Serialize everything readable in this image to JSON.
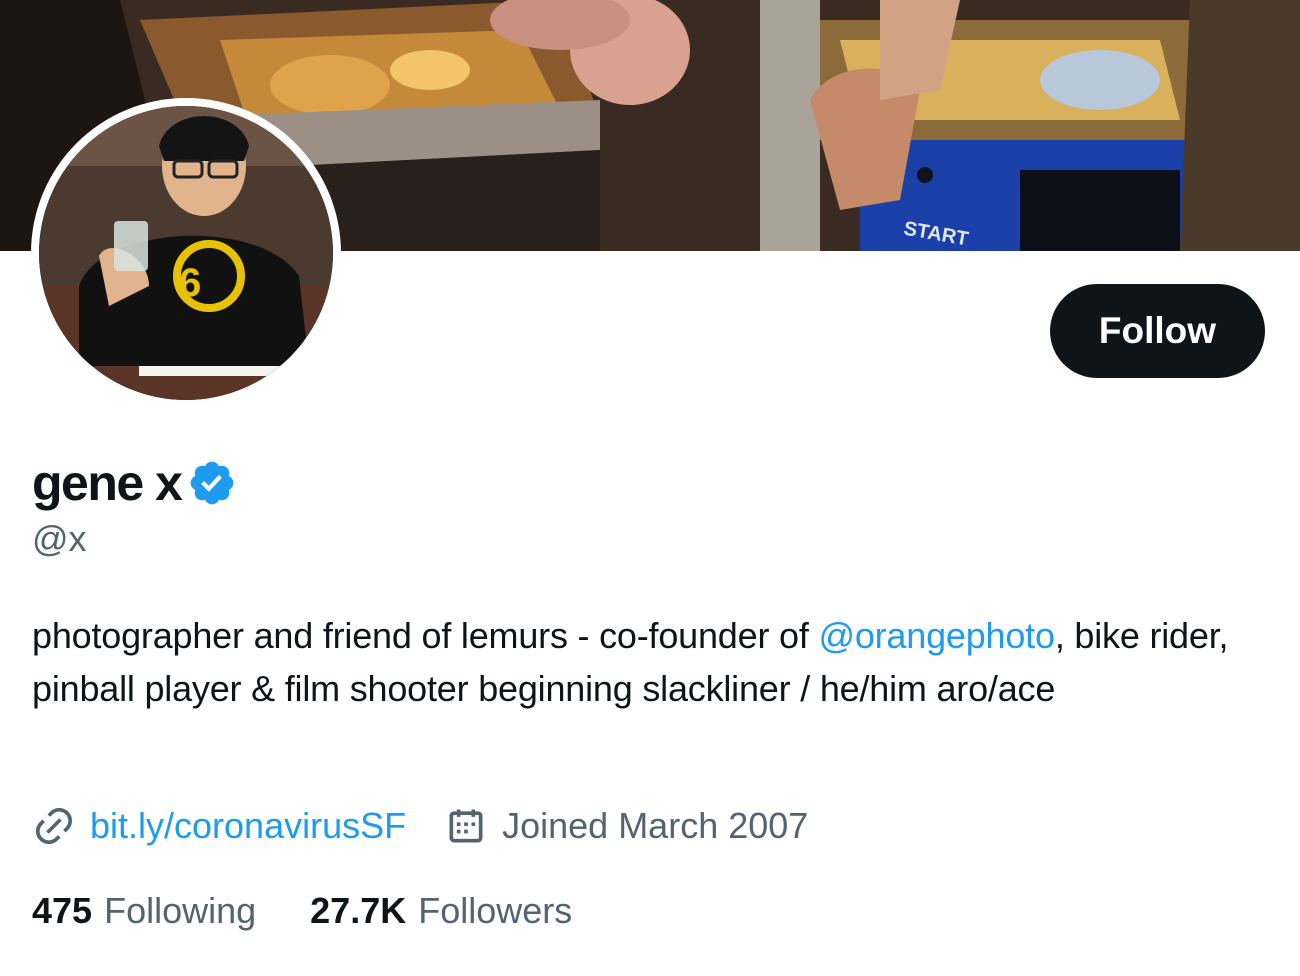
{
  "profile": {
    "display_name": "gene x",
    "handle": "@x",
    "verified": true,
    "follow_label": "Follow",
    "bio": {
      "text_before": "photographer and friend of lemurs - co-founder of ",
      "mention": "@orangephoto",
      "text_after": ", bike rider, pinball player & film shooter beginning slackliner / he/him aro/ace"
    },
    "website": "bit.ly/coronavirusSF",
    "joined": "Joined March 2007",
    "following_count": "475",
    "following_label": "Following",
    "followers_count": "27.7K",
    "followers_label": "Followers"
  },
  "banner": {
    "start_label": "START"
  },
  "icons": {
    "verified": "verified-badge-icon",
    "link": "link-icon",
    "calendar": "calendar-icon"
  },
  "colors": {
    "accent": "#1d9bf0",
    "text_primary": "#0f1419",
    "text_secondary": "#536471",
    "button_bg": "#0f1419"
  }
}
